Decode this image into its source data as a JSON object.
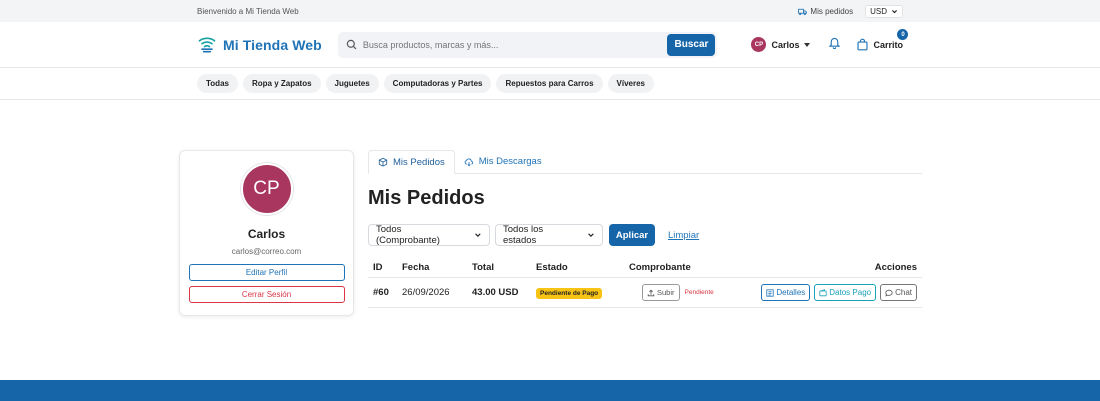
{
  "topbar": {
    "welcome": "Bienvenido a Mi Tienda Web",
    "orders_link": "Mis pedidos",
    "currency": "USD"
  },
  "header": {
    "logo_text": "Mi Tienda Web",
    "search_placeholder": "Busca productos, marcas y más...",
    "search_button": "Buscar",
    "user_initials": "CP",
    "user_name": "Carlos",
    "cart_label": "Carrito",
    "cart_count": "0"
  },
  "categories": [
    "Todas",
    "Ropa y Zapatos",
    "Juguetes",
    "Computadoras y Partes",
    "Repuestos para Carros",
    "Víveres"
  ],
  "profile": {
    "initials": "CP",
    "name": "Carlos",
    "email": "carlos@correo.com",
    "edit_button": "Editar Perfil",
    "logout_button": "Cerrar Sesión"
  },
  "tabs": [
    {
      "label": "Mis Pedidos",
      "icon": "box-icon"
    },
    {
      "label": "Mis Descargas",
      "icon": "cloud-download-icon"
    }
  ],
  "page_title": "Mis Pedidos",
  "filters": {
    "receipt_select": "Todos (Comprobante)",
    "status_select": "Todos los estados",
    "apply_button": "Aplicar",
    "clear_link": "Limpiar"
  },
  "table": {
    "headers": [
      "ID",
      "Fecha",
      "Total",
      "Estado",
      "Comprobante",
      "Acciones"
    ],
    "rows": [
      {
        "id": "#60",
        "date": "26/09/2026",
        "total": "43.00 USD",
        "status": "Pendiente de Pago",
        "upload_button": "Subir",
        "receipt_status": "Pendiente",
        "details_button": "Detalles",
        "payment_button": "Datos Pago",
        "chat_button": "Chat"
      }
    ]
  },
  "colors": {
    "brand": "#1565a8",
    "avatar": "#a8365f",
    "status_pending": "#f7c315",
    "danger": "#dc3545",
    "teal": "#17a2b8"
  }
}
